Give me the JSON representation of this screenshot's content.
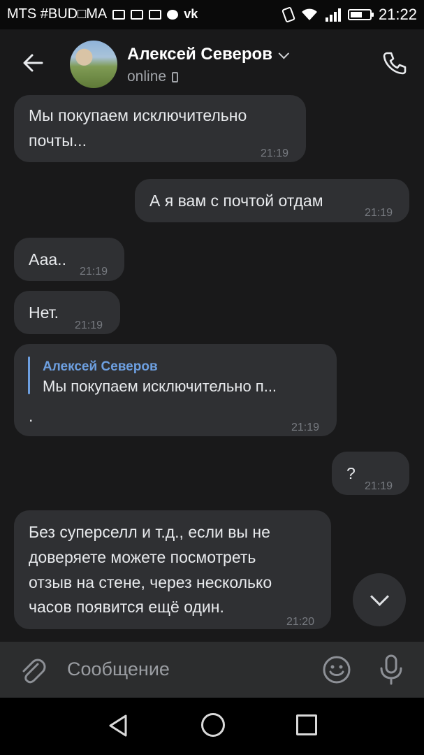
{
  "status_bar": {
    "carrier": "MTS #BUD□MA",
    "time": "21:22"
  },
  "header": {
    "contact_name": "Алексей Северов",
    "presence": "online"
  },
  "messages": [
    {
      "text_line1": "Мы покупаем исключительно",
      "text_line2": "почты...",
      "time": "21:19"
    },
    {
      "text": "А я вам с почтой отдам",
      "time": "21:19"
    },
    {
      "text": "Ааа..",
      "time": "21:19"
    },
    {
      "text": "Нет.",
      "time": "21:19"
    },
    {
      "reply_author": "Алексей Северов",
      "reply_text": "Мы покупаем исключительно п...",
      "text": ".",
      "time": "21:19"
    },
    {
      "text": "?",
      "time": "21:19"
    },
    {
      "lines": [
        "Без суперселл и т.д., если вы не",
        "доверяете можете посмотреть",
        "отзыв на стене, через несколько",
        "часов появится ещё один."
      ],
      "time": "21:20"
    }
  ],
  "composer": {
    "placeholder": "Сообщение"
  },
  "icons": [
    "back-arrow-icon",
    "chevron-down-icon",
    "phone-icon",
    "attach-icon",
    "smile-icon",
    "mic-icon",
    "nav-back-icon",
    "nav-home-icon",
    "nav-recent-icon"
  ]
}
